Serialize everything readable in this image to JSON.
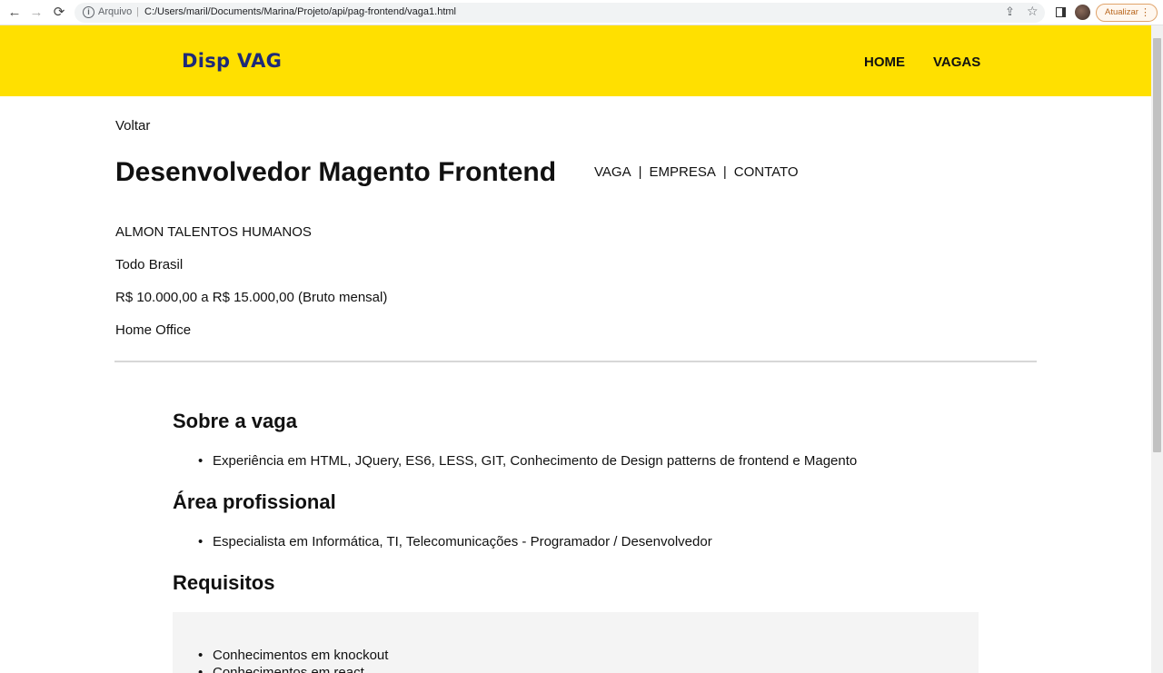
{
  "browser": {
    "back": "←",
    "forward": "→",
    "reload": "⟳",
    "scheme_label": "Arquivo",
    "separator": "|",
    "url": "C:/Users/maril/Documents/Marina/Projeto/api/pag-frontend/vaga1.html",
    "update_label": "Atualizar",
    "update_menu": "⋮"
  },
  "header": {
    "logo": "Disp VAG",
    "nav": [
      "HOME",
      "VAGAS"
    ]
  },
  "page": {
    "back_link": "Voltar",
    "title": "Desenvolvedor Magento Frontend",
    "tabs": [
      "VAGA",
      "EMPRESA",
      "CONTATO"
    ],
    "tab_separator": "|",
    "company": "ALMON TALENTOS HUMANOS",
    "location": "Todo Brasil",
    "salary": "R$ 10.000,00 a R$ 15.000,00 (Bruto mensal)",
    "work_mode": "Home Office"
  },
  "sections": {
    "about": {
      "heading": "Sobre a vaga",
      "items": [
        "Experiência em HTML, JQuery, ES6, LESS, GIT, Conhecimento de Design patterns de frontend e Magento"
      ]
    },
    "area": {
      "heading": "Área profissional",
      "items": [
        "Especialista em Informática, TI, Telecomunicações - Programador / Desenvolvedor"
      ]
    },
    "requirements": {
      "heading": "Requisitos",
      "items": [
        "Conhecimentos em knockout",
        "Conhecimentos em react"
      ]
    }
  },
  "colors": {
    "header_bg": "#ffe000",
    "logo": "#1e2a78",
    "requirements_bg": "#f4f4f4"
  }
}
